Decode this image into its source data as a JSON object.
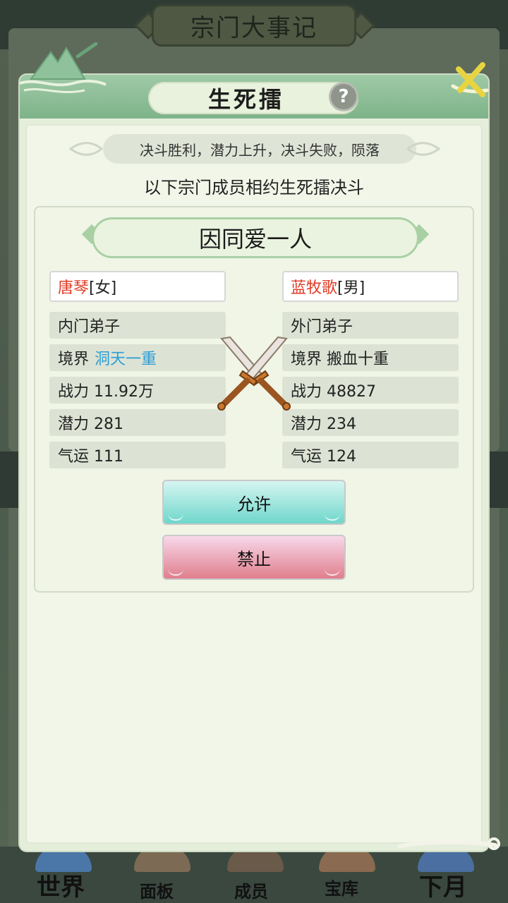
{
  "background": {
    "header_title": "宗门大事记",
    "nav": [
      {
        "label": "世界"
      },
      {
        "label": "面板"
      },
      {
        "label": "成员"
      },
      {
        "label": "宝库"
      },
      {
        "label": "下月"
      }
    ]
  },
  "modal": {
    "title": "生死擂",
    "help_icon": "question-mark",
    "help_label": "?",
    "close_icon": "close-x",
    "rule_text": "决斗胜利，潜力上升，决斗失败，陨落",
    "subtitle": "以下宗门成员相约生死擂决斗",
    "reason": "因同爱一人",
    "left": {
      "name": "唐琴",
      "gender": "[女]",
      "rank": "内门弟子",
      "realm_label": "境界",
      "realm_value": "洞天一重",
      "power": "战力 11.92万",
      "potential": "潜力 281",
      "luck": "气运 111"
    },
    "right": {
      "name": "蓝牧歌",
      "gender": "[男]",
      "rank": "外门弟子",
      "realm": "境界 搬血十重",
      "power": "战力 48827",
      "potential": "潜力 234",
      "luck": "气运 124"
    },
    "allow_label": "允许",
    "forbid_label": "禁止"
  },
  "colors": {
    "name_red": "#e13b25",
    "realm_blue": "#2c9ed6",
    "header_green": "#8fc29a",
    "allow_teal": "#6fd7cb",
    "forbid_pink": "#e07f8d"
  }
}
